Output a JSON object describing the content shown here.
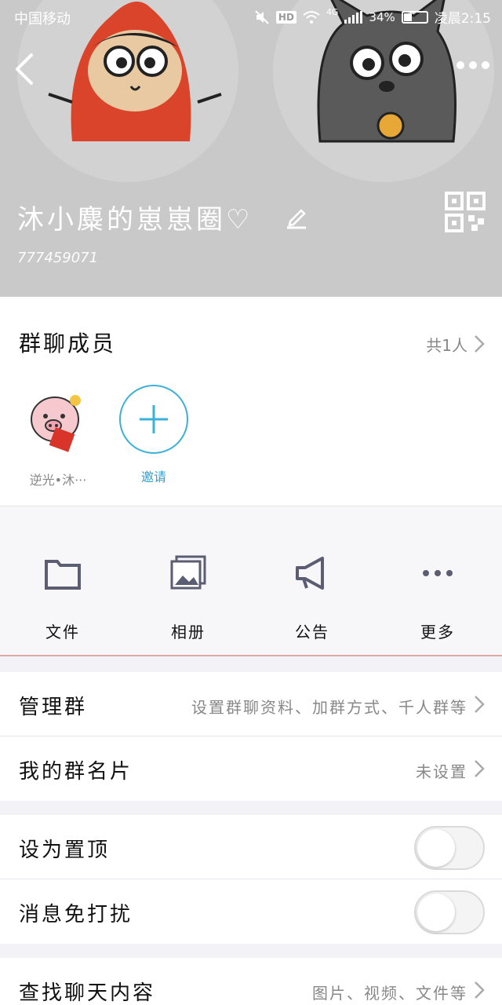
{
  "status_bar": {
    "carrier": "中国移动",
    "hd": "HD",
    "network": "4G",
    "battery": "34%",
    "time": "凌晨2:15"
  },
  "header": {
    "group_name": "沐小麋的崽崽圈♡",
    "group_id": "777459071"
  },
  "members": {
    "title": "群聊成员",
    "count": "共1人",
    "list": [
      {
        "name": "逆光•沐···"
      }
    ],
    "invite_label": "邀请"
  },
  "features": [
    {
      "label": "文件",
      "icon": "folder-icon"
    },
    {
      "label": "相册",
      "icon": "album-icon"
    },
    {
      "label": "公告",
      "icon": "megaphone-icon"
    },
    {
      "label": "更多",
      "icon": "more-icon"
    }
  ],
  "rows": {
    "manage": {
      "label": "管理群",
      "value": "设置群聊资料、加群方式、千人群等"
    },
    "card": {
      "label": "我的群名片",
      "value": "未设置"
    },
    "pin": {
      "label": "设为置顶",
      "on": false
    },
    "mute": {
      "label": "消息免打扰",
      "on": false
    },
    "search": {
      "label": "查找聊天内容",
      "value": "图片、视频、文件等"
    }
  },
  "colors": {
    "header_bg": "#c9c9c9",
    "accent": "#2ea1d2",
    "page_bg": "#f2f2f7"
  }
}
